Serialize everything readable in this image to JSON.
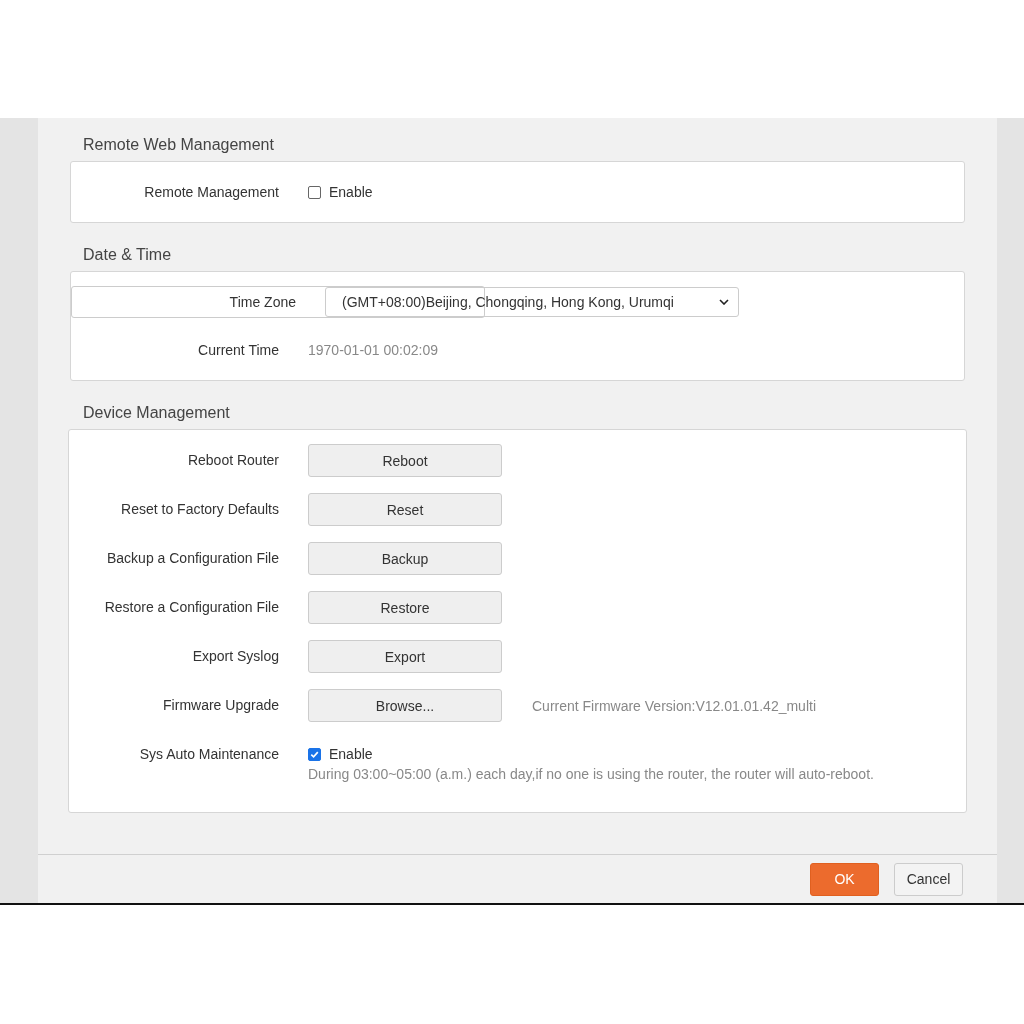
{
  "sections": [
    {
      "title": "Remote Web Management",
      "rows": [
        {
          "kind": "checkbox",
          "label": "Remote Management",
          "option": "Enable",
          "checked": false
        }
      ]
    },
    {
      "title": "Date & Time",
      "rows": [
        {
          "kind": "select",
          "label": "Time Zone",
          "value": "(GMT+08:00)Beijing, Chongqing, Hong Kong, Urumqi"
        },
        {
          "kind": "text",
          "label": "Current Time",
          "value": "1970-01-01 00:02:09"
        }
      ]
    },
    {
      "title": "Device Management",
      "rows": [
        {
          "kind": "button",
          "label": "Reboot Router",
          "button": "Reboot"
        },
        {
          "kind": "button",
          "label": "Reset to Factory Defaults",
          "button": "Reset"
        },
        {
          "kind": "button",
          "label": "Backup a Configuration File",
          "button": "Backup"
        },
        {
          "kind": "button",
          "label": "Restore a Configuration File",
          "button": "Restore"
        },
        {
          "kind": "button",
          "label": "Export Syslog",
          "button": "Export"
        },
        {
          "kind": "button",
          "label": "Firmware Upgrade",
          "button": "Browse...",
          "note": "Current Firmware Version:V12.01.01.42_multi"
        },
        {
          "kind": "checkbox",
          "label": "Sys Auto Maintenance",
          "option": "Enable",
          "checked": true,
          "hint": "During 03:00~05:00 (a.m.) each day,if no one is using the router, the router will auto-reboot."
        }
      ]
    }
  ],
  "footer": {
    "buttons": [
      {
        "label": "OK",
        "kind": "primary"
      },
      {
        "label": "Cancel",
        "kind": "default"
      }
    ]
  }
}
